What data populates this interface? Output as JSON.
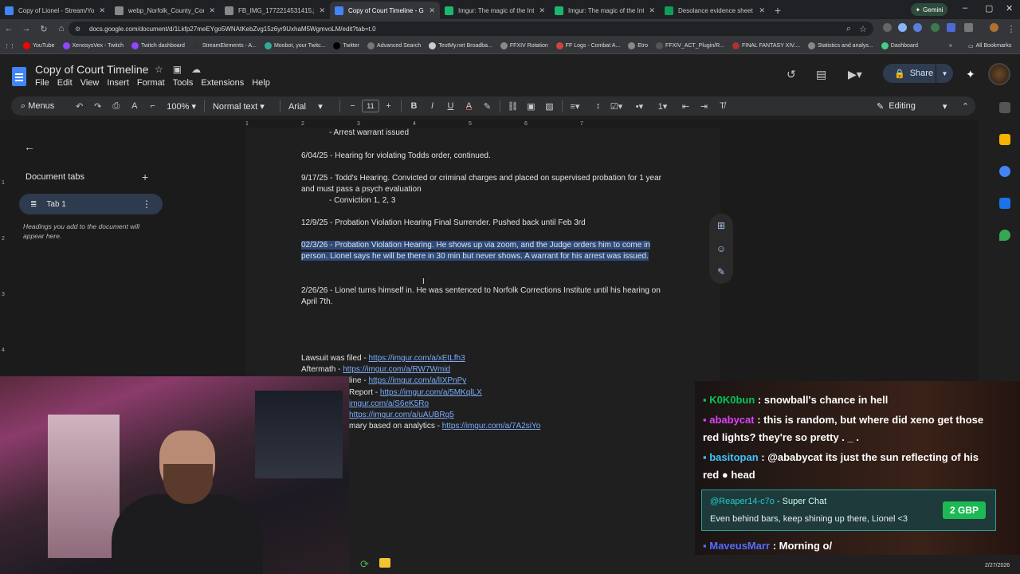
{
  "browser": {
    "tabs": [
      {
        "label": "Copy of Lionel - Stream/Youtub",
        "color": "#4285f4"
      },
      {
        "label": "webp_Norfolk_County_Correcti",
        "color": "#888888"
      },
      {
        "label": "FB_IMG_1772214531415.jpg (9",
        "color": "#888888"
      },
      {
        "label": "Copy of Court Timeline - Goog",
        "color": "#4285f4",
        "active": true
      },
      {
        "label": "Imgur: The magic of the Intern",
        "color": "#1bb76e"
      },
      {
        "label": "Imgur: The magic of the Intern",
        "color": "#1bb76e"
      },
      {
        "label": "Desolance evidence sheet - Go",
        "color": "#0f9d58"
      }
    ],
    "gemini_label": "Gemini",
    "url": "docs.google.com/document/d/1Lkfp27meEYgo5WNAtKebZvg15z6yr9UxhaM5WgmvoLM/edit?tab=t.0",
    "bookmarks": [
      "YouTube",
      "XenosysVex - Twitch",
      "Twitch dashboard",
      "StreamElements - A...",
      "Moobot, your Twitc...",
      "Twitter",
      "Advanced Search",
      "TestMy.net Broadba...",
      "FFXIV Rotation",
      "FF Logs - Combat A...",
      "Etro",
      "FFXIV_ACT_Plugin/R...",
      "FINAL FANTASY XIV....",
      "Statistics and analys...",
      "Dashboard"
    ],
    "all_bookmarks": "All Bookmarks"
  },
  "docs": {
    "title": "Copy of Court Timeline",
    "menu": [
      "File",
      "Edit",
      "View",
      "Insert",
      "Format",
      "Tools",
      "Extensions",
      "Help"
    ],
    "share_label": "Share",
    "toolbar": {
      "menus": "Menus",
      "zoom": "100%",
      "style": "Normal text",
      "font": "Arial",
      "size": "11",
      "mode": "Editing"
    },
    "ruler": [
      "1",
      "2",
      "3",
      "4",
      "5",
      "6",
      "7"
    ],
    "vruler": [
      "1",
      "2",
      "3",
      "4",
      "5"
    ],
    "sidebar": {
      "heading": "Document tabs",
      "tab": "Tab 1",
      "hint": "Headings you add to the document will appear here."
    },
    "lines": {
      "l0": "- Arrest warrant issued",
      "l1": "6/04/25 - Hearing for violating Todds order, continued.",
      "l2": "9/17/25 - Todd's Hearing. Convicted or criminal charges and placed on supervised probation for 1 year and must pass a psych evaluation",
      "l3": "- Conviction 1, 2, 3",
      "l4": "12/9/25 - Probation Violation Hearing Final Surrender. Pushed back until Feb 3rd",
      "l5": "02/3/26 - Probation Violation Hearing. He shows up via zoom, and the Judge orders him to come in person. Lionel says he will be there in 30 min but never shows. A warrant for his arrest was issued.",
      "l6": "2/26/26 - Lionel turns himself in. He was sentenced to Norfolk Corrections Institute until his hearing on April 7th."
    },
    "links": [
      {
        "prefix": "Lawsuit was filed - ",
        "url": "https://imgur.com/a/xEtLfh3"
      },
      {
        "prefix": "Aftermath - ",
        "url": "https://imgur.com/a/RW7Wmid"
      },
      {
        "prefix": "line - ",
        "url": "https://imgur.com/a/lIXPnPy"
      },
      {
        "prefix": "Report - ",
        "url": "https://imgur.com/a/5MKqlLX"
      },
      {
        "prefix": "",
        "url": "imgur.com/a/S6eK5Ro"
      },
      {
        "prefix": "",
        "url": "https://imgur.com/a/uAUBRq5"
      },
      {
        "prefix": "mary based on analytics - ",
        "url": "https://imgur.com/a/7A2siYo"
      }
    ]
  },
  "chat": {
    "messages": [
      {
        "user": "K0K0bun",
        "text": ": snowball's chance in hell",
        "color": "#00c853"
      },
      {
        "user": "ababycat",
        "text": ": this is random, but where did xeno get those red lights? they're so pretty . _ .",
        "color": "#e040fb"
      },
      {
        "user": "basitopan",
        "text": ": @ababycat its just the sun reflecting of his red",
        "suffix": "head",
        "color": "#40c4ff"
      },
      {
        "user": "MaveusMarr",
        "text": ": Morning o/",
        "color": "#536dfe"
      }
    ],
    "superchat": {
      "user": "@Reaper14-c7o",
      "label": "- Super Chat",
      "message": "Even behind bars, keep shining up there, Lionel <3",
      "amount": "2 GBP"
    }
  },
  "taskbar": {
    "date": "2/27/2026"
  }
}
